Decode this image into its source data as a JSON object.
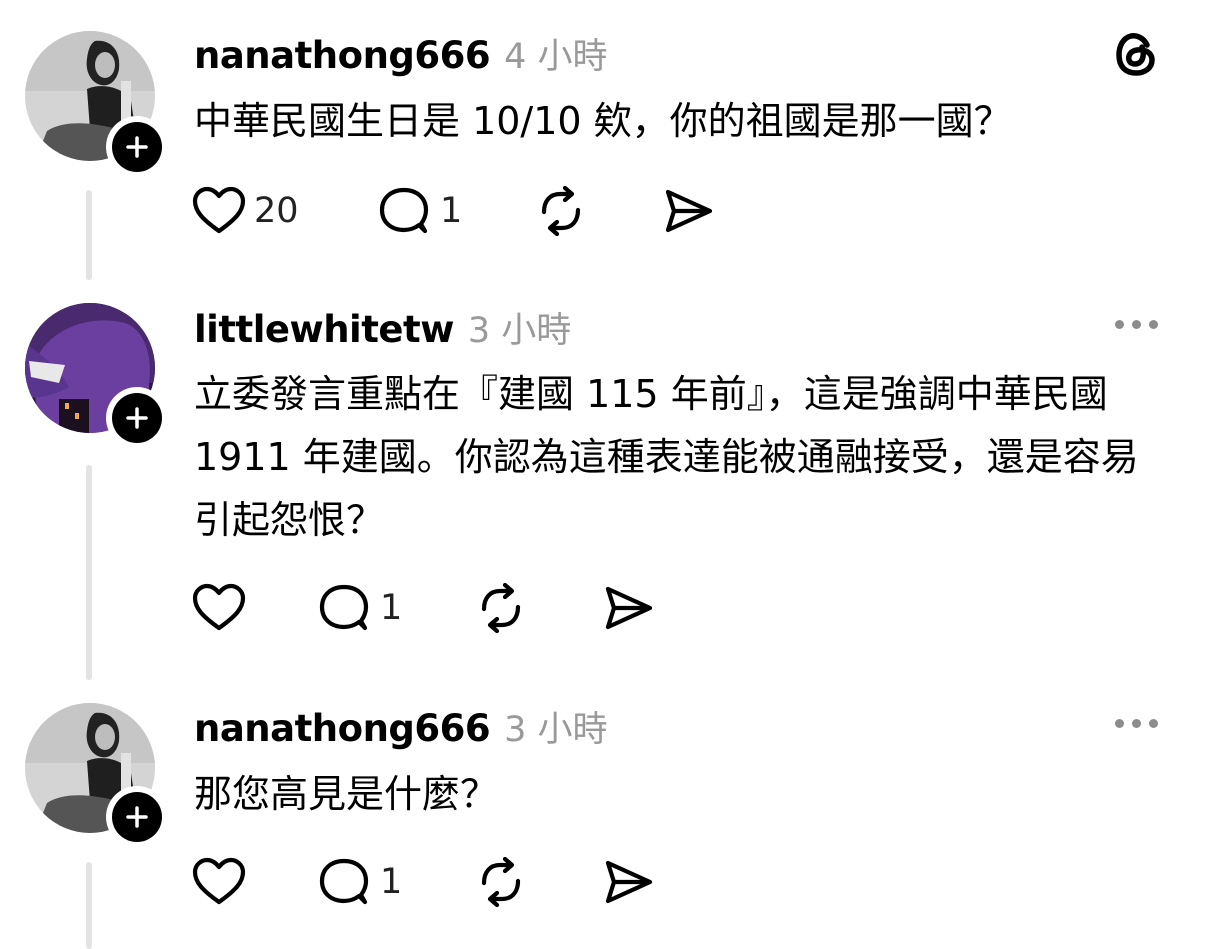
{
  "posts": [
    {
      "username": "nanathong666",
      "time": "4 小時",
      "content": "中華民國生日是 10/10 欸，你的祖國是那一國？",
      "likes": "20",
      "replies": "1"
    },
    {
      "username": "littlewhitetw",
      "time": "3 小時",
      "content": "立委發言重點在『建國 115 年前』，這是強調中華民國 1911 年建國。你認為這種表達能被通融接受，還是容易引起怨恨？",
      "likes": "",
      "replies": "1"
    },
    {
      "username": "nanathong666",
      "time": "3 小時",
      "content": "那您高見是什麼？",
      "likes": "",
      "replies": "1"
    }
  ],
  "icons": {
    "app_logo": "threads-logo-icon",
    "like": "heart-icon",
    "reply": "speech-bubble-icon",
    "repost": "repost-icon",
    "share": "send-icon",
    "follow": "plus-icon",
    "more": "more-dots-icon"
  },
  "colors": {
    "text": "#000000",
    "muted": "#999999",
    "thread_line": "#e3e3e3",
    "avatar2": "#6a3fa0"
  }
}
